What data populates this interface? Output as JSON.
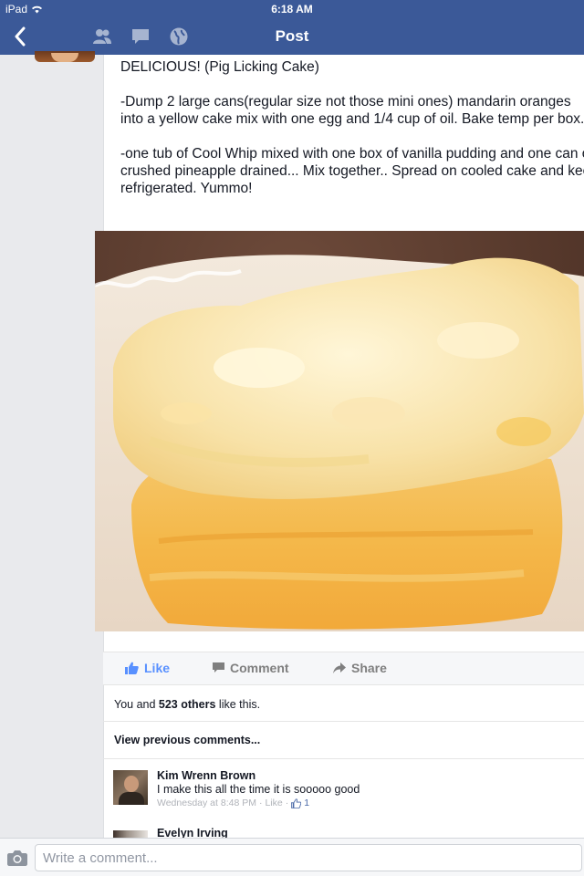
{
  "status_bar": {
    "carrier": "iPad",
    "time": "6:18 AM"
  },
  "nav": {
    "title": "Post",
    "icons": [
      "back-chevron-icon",
      "friends-icon",
      "messages-icon",
      "globe-icon"
    ]
  },
  "post": {
    "paragraphs": [
      "DELICIOUS!  (Pig Licking Cake)",
      "-Dump 2 large cans(regular size not those mini ones) mandarin oranges into a yellow cake mix with one egg and 1/4 cup of oil. Bake temp per box.",
      "-one tub of Cool Whip mixed with one box of vanilla pudding and one can of crushed pineapple drained... Mix together.. Spread on cooled cake and keep refrigerated. Yummo!"
    ]
  },
  "actions": {
    "like": "Like",
    "comment": "Comment",
    "share": "Share"
  },
  "likes_summary": {
    "prefix": "You and ",
    "count": "523 others",
    "suffix": " like this."
  },
  "view_previous": "View previous comments...",
  "comments": [
    {
      "name": "Kim Wrenn Brown",
      "text": "I make this all the time it is sooooo good",
      "time": "Wednesday at 8:48 PM",
      "like_label": "Like",
      "like_count": "1"
    },
    {
      "name": "Evelyn Irving"
    }
  ],
  "composer": {
    "placeholder": "Write a comment..."
  },
  "colors": {
    "header": "#3b5998",
    "link": "#5890ff",
    "background": "#e9eaed"
  }
}
